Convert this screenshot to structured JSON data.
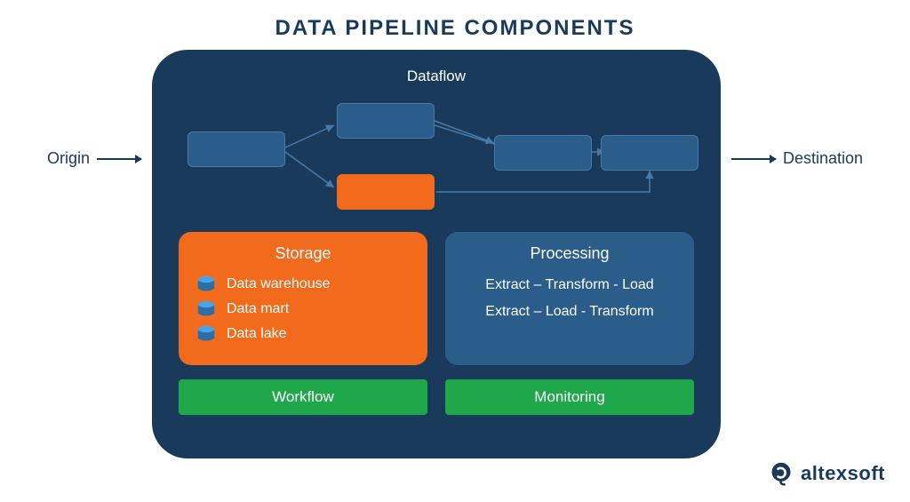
{
  "title": "DATA PIPELINE COMPONENTS",
  "origin_label": "Origin",
  "destination_label": "Destination",
  "dataflow_label": "Dataflow",
  "storage": {
    "title": "Storage",
    "items": [
      "Data warehouse",
      "Data mart",
      "Data lake"
    ]
  },
  "processing": {
    "title": "Processing",
    "line1": "Extract – Transform - Load",
    "line2": "Extract – Load - Transform"
  },
  "workflow_label": "Workflow",
  "monitoring_label": "Monitoring",
  "brand": "altexsoft",
  "colors": {
    "panel_bg": "#1a3a5c",
    "box_blue": "#2b5d8a",
    "box_orange": "#f26a1b",
    "bar_green": "#1fa84a"
  }
}
